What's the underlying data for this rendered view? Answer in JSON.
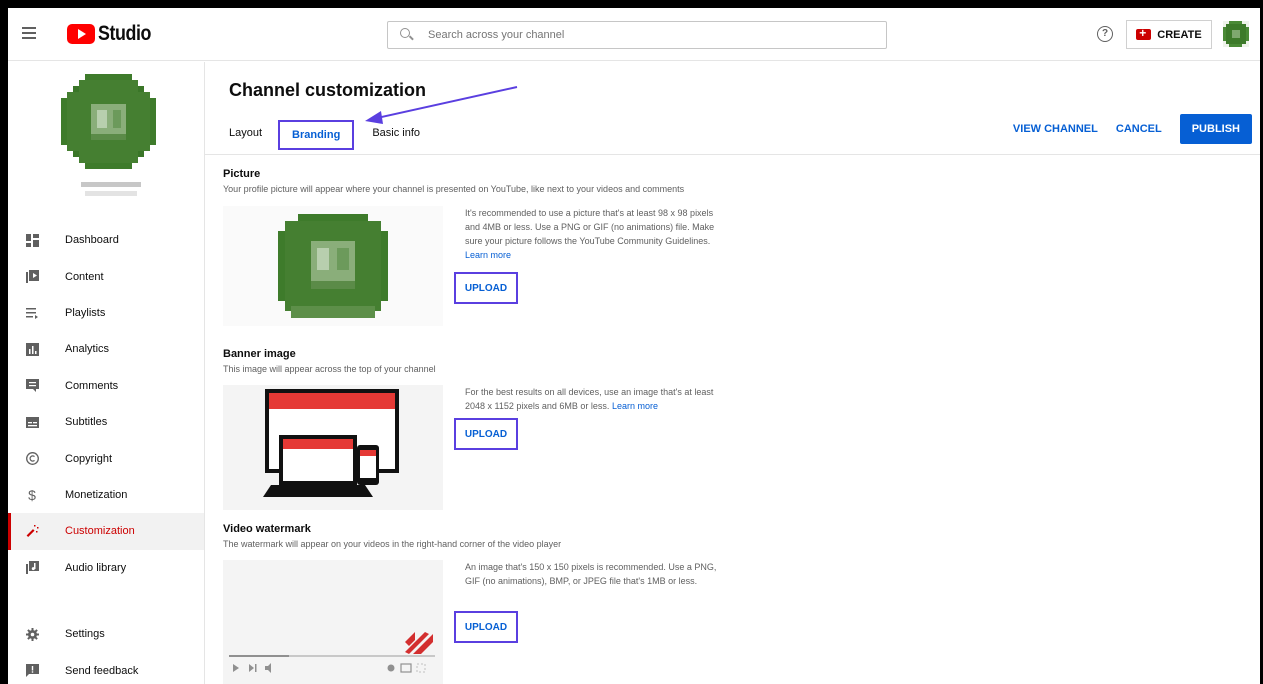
{
  "header": {
    "logo_text": "Studio",
    "search_placeholder": "Search across your channel",
    "help_label": "?",
    "create_label": "CREATE"
  },
  "sidebar": {
    "items": [
      {
        "label": "Dashboard",
        "icon": "dashboard-icon"
      },
      {
        "label": "Content",
        "icon": "content-icon"
      },
      {
        "label": "Playlists",
        "icon": "playlists-icon"
      },
      {
        "label": "Analytics",
        "icon": "analytics-icon"
      },
      {
        "label": "Comments",
        "icon": "comments-icon"
      },
      {
        "label": "Subtitles",
        "icon": "subtitles-icon"
      },
      {
        "label": "Copyright",
        "icon": "copyright-icon"
      },
      {
        "label": "Monetization",
        "icon": "monetization-icon"
      },
      {
        "label": "Customization",
        "icon": "customization-icon",
        "active": true
      },
      {
        "label": "Audio library",
        "icon": "audio-library-icon"
      }
    ],
    "bottom_items": [
      {
        "label": "Settings",
        "icon": "settings-icon"
      },
      {
        "label": "Send feedback",
        "icon": "feedback-icon"
      }
    ]
  },
  "main": {
    "title": "Channel customization",
    "tabs": [
      {
        "label": "Layout"
      },
      {
        "label": "Branding",
        "active": true
      },
      {
        "label": "Basic info"
      }
    ],
    "actions": {
      "view_channel": "VIEW CHANNEL",
      "cancel": "CANCEL",
      "publish": "PUBLISH"
    },
    "sections": {
      "picture": {
        "title": "Picture",
        "description": "Your profile picture will appear where your channel is presented on YouTube, like next to your videos and comments",
        "info": "It's recommended to use a picture that's at least 98 x 98 pixels and 4MB or less. Use a PNG or GIF (no animations) file. Make sure your picture follows the YouTube Community Guidelines.",
        "link": "Learn more",
        "upload": "UPLOAD"
      },
      "banner": {
        "title": "Banner image",
        "description": "This image will appear across the top of your channel",
        "info": "For the best results on all devices, use an image that's at least 2048 x 1152 pixels and 6MB or less.",
        "link": "Learn more",
        "upload": "UPLOAD"
      },
      "watermark": {
        "title": "Video watermark",
        "description": "The watermark will appear on your videos in the right-hand corner of the video player",
        "info": "An image that's 150 x 150 pixels is recommended. Use a PNG, GIF (no animations), BMP, or JPEG file that's 1MB or less.",
        "upload": "UPLOAD"
      }
    }
  },
  "colors": {
    "accent": "#065fd4",
    "brand_red": "#ff0000",
    "annotation": "#5a3fe0",
    "avatar_green": "#3d7a2a"
  }
}
